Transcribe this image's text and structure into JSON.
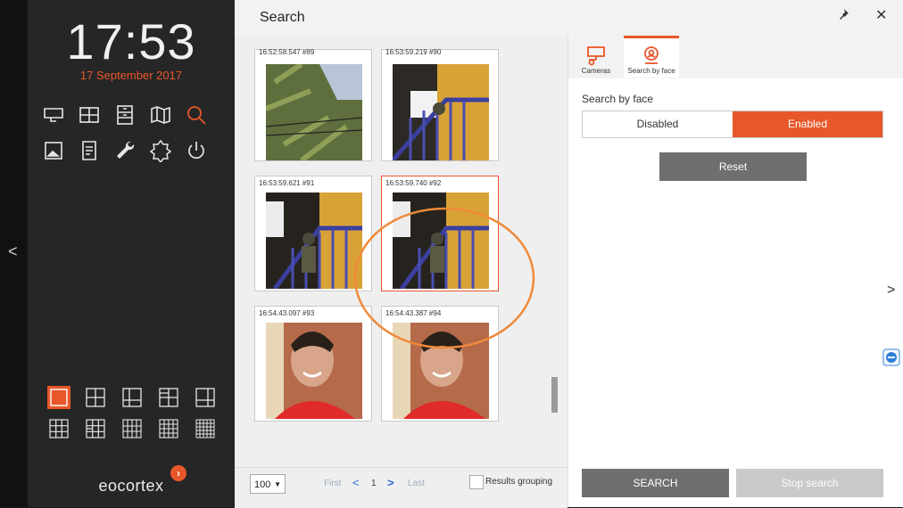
{
  "sidebar": {
    "time": "17:53",
    "date": "17 September 2017",
    "brand": "eocortex",
    "collapse_arrow": "<",
    "tool_icons": [
      "monitor-icon",
      "layout-icon",
      "archive-icon",
      "map-icon",
      "search-icon",
      "image-icon",
      "document-icon",
      "wrench-icon",
      "settings-icon",
      "power-icon"
    ],
    "layout_icons": [
      "layout-1x1",
      "layout-2x2",
      "layout-1-3",
      "layout-2x2-b",
      "layout-1-5",
      "layout-3x3",
      "layout-3x3-b",
      "layout-4x4-a",
      "layout-4x4-b",
      "layout-5x5"
    ]
  },
  "window": {
    "title": "Search",
    "pin_glyph": "✖",
    "close_glyph": "✕"
  },
  "results": {
    "items": [
      {
        "caption": "16:52:58.547 #89"
      },
      {
        "caption": "16:53:59.219 #90"
      },
      {
        "caption": "16:53:59.621 #91"
      },
      {
        "caption": "16:53:59.740 #92"
      },
      {
        "caption": "16:54:43.097 #93"
      },
      {
        "caption": "16:54:43.387 #94"
      }
    ],
    "selected_index": 3
  },
  "pager": {
    "per_page": "100",
    "first": "First",
    "prev": "<",
    "page": "1",
    "next": ">",
    "last": "Last",
    "grouping_label": "Results grouping"
  },
  "right_panel": {
    "tabs": [
      {
        "label": "Cameras",
        "icon": "camera-icon"
      },
      {
        "label": "Search by face",
        "icon": "face-search-icon"
      }
    ],
    "search_by_face_label": "Search by face",
    "disabled_label": "Disabled",
    "enabled_label": "Enabled",
    "reset_label": "Reset",
    "search_label": "SEARCH",
    "stop_label": "Stop search",
    "next_arrow": ">"
  },
  "colors": {
    "accent": "#e8572a",
    "sidebar_bg": "#262626",
    "button_gray": "#6f6f6f",
    "button_disabled": "#c9c9c9"
  }
}
